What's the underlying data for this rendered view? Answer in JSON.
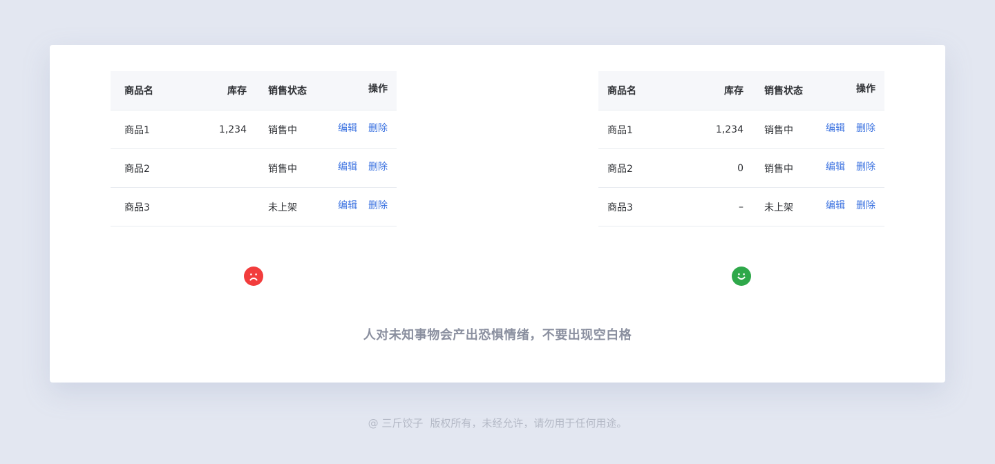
{
  "tables": {
    "left": {
      "headers": {
        "name": "商品名",
        "stock": "库存",
        "status": "销售状态",
        "ops": "操作"
      },
      "rows": [
        {
          "name": "商品1",
          "stock": "1,234",
          "status": "销售中",
          "edit": "编辑",
          "delete": "删除"
        },
        {
          "name": "商品2",
          "stock": "",
          "status": "销售中",
          "edit": "编辑",
          "delete": "删除"
        },
        {
          "name": "商品3",
          "stock": "",
          "status": "未上架",
          "edit": "编辑",
          "delete": "删除"
        }
      ]
    },
    "right": {
      "headers": {
        "name": "商品名",
        "stock": "库存",
        "status": "销售状态",
        "ops": "操作"
      },
      "rows": [
        {
          "name": "商品1",
          "stock": "1,234",
          "status": "销售中",
          "edit": "编辑",
          "delete": "删除"
        },
        {
          "name": "商品2",
          "stock": "0",
          "status": "销售中",
          "edit": "编辑",
          "delete": "删除"
        },
        {
          "name": "商品3",
          "stock": "–",
          "status": "未上架",
          "edit": "编辑",
          "delete": "删除"
        }
      ]
    }
  },
  "indicators": {
    "bad": {
      "icon": "sad-face-icon",
      "color": "#f23c3c"
    },
    "good": {
      "icon": "happy-face-icon",
      "color": "#2ea84a"
    }
  },
  "caption": "人对未知事物会产出恐惧情绪，不要出现空白格",
  "footer": {
    "author": "@ 三斤饺子",
    "notice": "版权所有，未经允许，请勿用于任何用途。"
  },
  "colors": {
    "page_bg": "#e3e7f1",
    "card_bg": "#ffffff",
    "header_bg": "#f6f7fa",
    "link": "#3b72e0",
    "caption": "#8a8f9f",
    "footer": "#b4b9c6"
  }
}
